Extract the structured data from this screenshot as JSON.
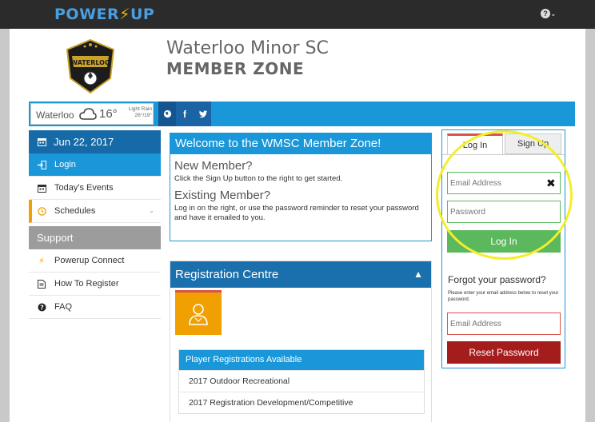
{
  "topbar": {
    "logo_left": "POWER",
    "logo_right": "UP",
    "help_caret": "⌄"
  },
  "brand": {
    "crest_text": "WATERLOO",
    "club_name": "Waterloo Minor SC",
    "zone_name": "MEMBER ZONE"
  },
  "weather": {
    "city": "Waterloo",
    "temp": "16°",
    "condition": "Light Rain",
    "range": "26°/19°"
  },
  "sidebar": {
    "date": "Jun 22, 2017",
    "items": [
      {
        "label": "Login"
      },
      {
        "label": "Today's Events"
      },
      {
        "label": "Schedules"
      }
    ],
    "support_title": "Support",
    "support_items": [
      {
        "label": "Powerup Connect"
      },
      {
        "label": "How To Register"
      },
      {
        "label": "FAQ"
      }
    ]
  },
  "welcome": {
    "title": "Welcome to the WMSC Member Zone!",
    "new_heading": "New Member?",
    "new_text": "Click the Sign Up button to the right to get started.",
    "existing_heading": "Existing Member?",
    "existing_text": "Log in on the right, or use the password reminder to reset your password and have it emailed to you."
  },
  "registration": {
    "title": "Registration Centre",
    "list_title": "Player Registrations Available",
    "rows": [
      "2017 Outdoor Recreational",
      "2017 Registration Development/Competitive"
    ]
  },
  "login": {
    "tab_login": "Log In",
    "tab_signup": "Sign Up",
    "email_placeholder": "Email Address",
    "password_placeholder": "Password",
    "login_button": "Log In",
    "forgot_title": "Forgot your password?",
    "forgot_text": "Please enter your email address below to reset your password.",
    "reset_email_placeholder": "Email Address",
    "reset_button": "Reset Password"
  },
  "colors": {
    "accent": "#1a97d9",
    "dark_blue": "#166aa8",
    "green": "#5cb85c",
    "red": "#a51c1c",
    "orange": "#f0a000",
    "highlight": "#f4ee2a"
  }
}
